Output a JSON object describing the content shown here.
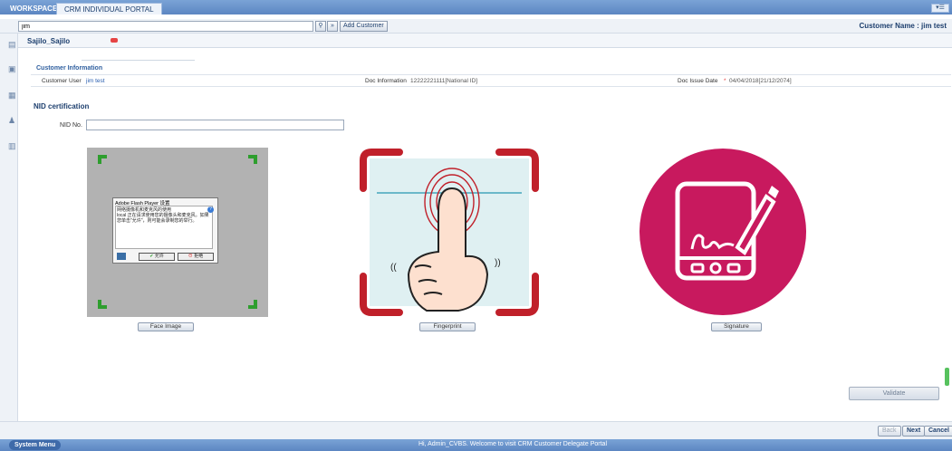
{
  "topbar": {
    "workspace_label": "WORKSPACE",
    "portal_tab": "CRM INDIVIDUAL PORTAL",
    "menu_icon": "menu-collapse-icon"
  },
  "search": {
    "value": "jim",
    "search_icon": "search-icon",
    "forward_icon": "double-chevron-icon",
    "add_customer_label": "Add Customer",
    "customer_name": "Customer Name : jim test"
  },
  "subtab": {
    "label": "Sajilo_Sajilo"
  },
  "customer_info": {
    "title": "Customer Information",
    "user_label": "Customer User",
    "user_value": "jim test",
    "doc_info_label": "Doc Information",
    "doc_info_value": "12222221111[National ID]",
    "doc_issue_label": "Doc Issue Date",
    "doc_issue_required": "*",
    "doc_issue_value": "04/04/2018[21/12/2074]"
  },
  "nid": {
    "title": "NID certification",
    "no_label": "NID No.",
    "no_value": ""
  },
  "capture": {
    "face_label": "Face Image",
    "fingerprint_label": "Fingerprint",
    "signature_label": "Signature",
    "flash_dialog": {
      "title": "Adobe Flash Player 设置",
      "text": "网络摄像机和麦克风的使用",
      "text2": "local 正在请求使用您的摄像头和麦克风。如果您单击\"允许\"，则可能会录制您的举行。",
      "allow": "允许",
      "deny": "拒绝"
    }
  },
  "actions": {
    "validate_label": "Validate",
    "back_label": "Back",
    "next_label": "Next",
    "cancel_label": "Cancel"
  },
  "statusbar": {
    "system_menu": "System Menu",
    "welcome": "Hi, Admin_CVBS. Welcome to visit CRM Customer Delegate Portal"
  },
  "colors": {
    "accent": "#5c86c2",
    "signature_bg": "#c8195e",
    "fingerprint_frame": "#c0202a",
    "face_corner": "#2e9e2e"
  }
}
